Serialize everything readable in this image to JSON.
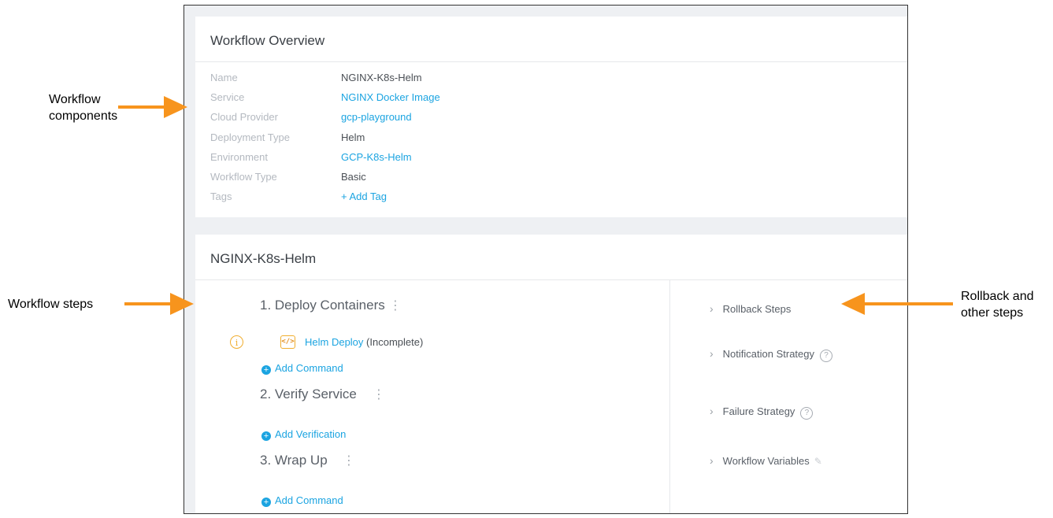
{
  "overview": {
    "title": "Workflow Overview",
    "rows": [
      {
        "label": "Name",
        "value": "NGINX-K8s-Helm"
      },
      {
        "label": "Service",
        "value": "NGINX Docker Image"
      },
      {
        "label": "Cloud Provider",
        "value": "gcp-playground"
      },
      {
        "label": "Deployment Type",
        "value": "Helm"
      },
      {
        "label": "Environment",
        "value": "GCP-K8s-Helm"
      },
      {
        "label": "Workflow Type",
        "value": "Basic"
      },
      {
        "label": "Tags",
        "value": "+ Add Tag"
      }
    ]
  },
  "workflow": {
    "title": "NGINX-K8s-Helm",
    "steps": [
      {
        "title": "1. Deploy Containers",
        "add_label": "Add Command"
      },
      {
        "title": "2. Verify Service",
        "add_label": "Add Verification"
      },
      {
        "title": "3. Wrap Up",
        "add_label": "Add Command"
      }
    ],
    "command": {
      "link": "Helm Deploy",
      "status": "(Incomplete)"
    },
    "side_items": [
      {
        "label": "Rollback Steps"
      },
      {
        "label": "Notification Strategy"
      },
      {
        "label": "Failure Strategy"
      },
      {
        "label": "Workflow Variables"
      }
    ]
  },
  "annotations": {
    "components": [
      "Workflow",
      "components"
    ],
    "steps": "Workflow steps",
    "rollback": [
      "Rollback and",
      "other steps"
    ]
  },
  "colors": {
    "accent": "#1ba4e1",
    "arrow": "#f7941d",
    "warning": "#f0ad2e"
  }
}
